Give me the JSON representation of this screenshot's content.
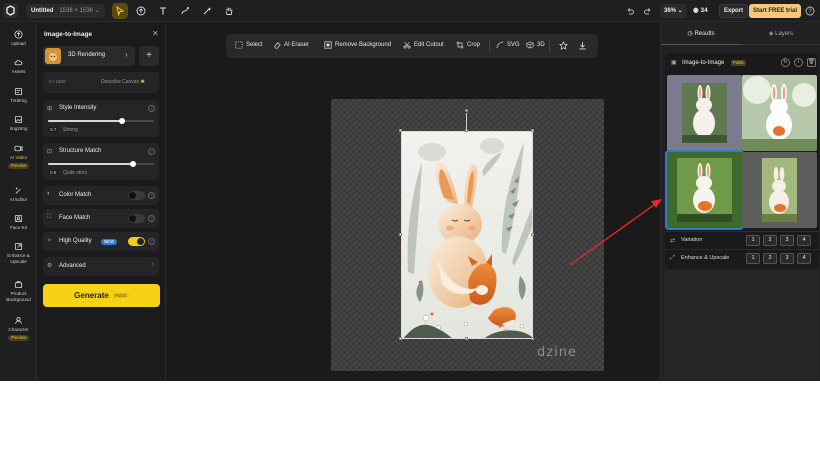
{
  "topbar": {
    "doc_title": "Untitled",
    "doc_size": "1536 × 1536",
    "zoom": "36%",
    "credits": "34",
    "export_label": "Export",
    "trial_label": "Start FREE trial"
  },
  "rail": {
    "items": [
      {
        "label": "Upload",
        "icon": "upload-icon"
      },
      {
        "label": "Assets",
        "icon": "cloud-icon"
      },
      {
        "label": "Txt2Img",
        "icon": "text-image-icon"
      },
      {
        "label": "Img2Img",
        "icon": "image-image-icon"
      },
      {
        "label": "AI Video",
        "icon": "video-icon",
        "badge": "Preview"
      },
      {
        "label": "AI Editor",
        "icon": "magic-icon"
      },
      {
        "label": "Face Kit",
        "icon": "face-icon"
      },
      {
        "label": "Enhance & Upscale",
        "icon": "enhance-icon"
      },
      {
        "label": "Product Background",
        "icon": "product-icon"
      },
      {
        "label": "Character",
        "icon": "character-icon",
        "badge": "Preview"
      }
    ]
  },
  "panel": {
    "title": "Image-to-Image",
    "style_name": "3D Rendering",
    "prompt_count": "0 / 1800",
    "prompt_hint": "Describe Canvas",
    "style_intensity": {
      "label": "Style Intensity",
      "value": "0.7",
      "text": "Strong",
      "level": 0.7
    },
    "structure_match": {
      "label": "Structure Match",
      "value": "0.8",
      "text": "Quite strict",
      "level": 0.8
    },
    "color_match": {
      "label": "Color Match",
      "on": false
    },
    "face_match": {
      "label": "Face Match",
      "on": false
    },
    "high_quality": {
      "label": "High Quality",
      "badge": "NEW",
      "on": true
    },
    "advanced": "Advanced",
    "generate": "Generate",
    "generate_sub": "Public"
  },
  "canvas_toolbar": {
    "select": "Select",
    "eraser": "AI Eraser",
    "remove_bg": "Remove Background",
    "cutout": "Edit Cutout",
    "crop": "Crop",
    "svg": "SVG",
    "three_d": "3D"
  },
  "canvas": {
    "watermark": "dzine"
  },
  "results": {
    "tab_results": "Results",
    "tab_layers": "Layers",
    "card_title": "Image-to-Image",
    "card_badge": "Public",
    "variation": "Variation",
    "enhance": "Enhance & Upscale",
    "numbers": [
      "1",
      "2",
      "3",
      "4"
    ]
  },
  "colors": {
    "accent": "#f5d118",
    "select": "#2f7dd1",
    "arrow": "#e0282c"
  }
}
